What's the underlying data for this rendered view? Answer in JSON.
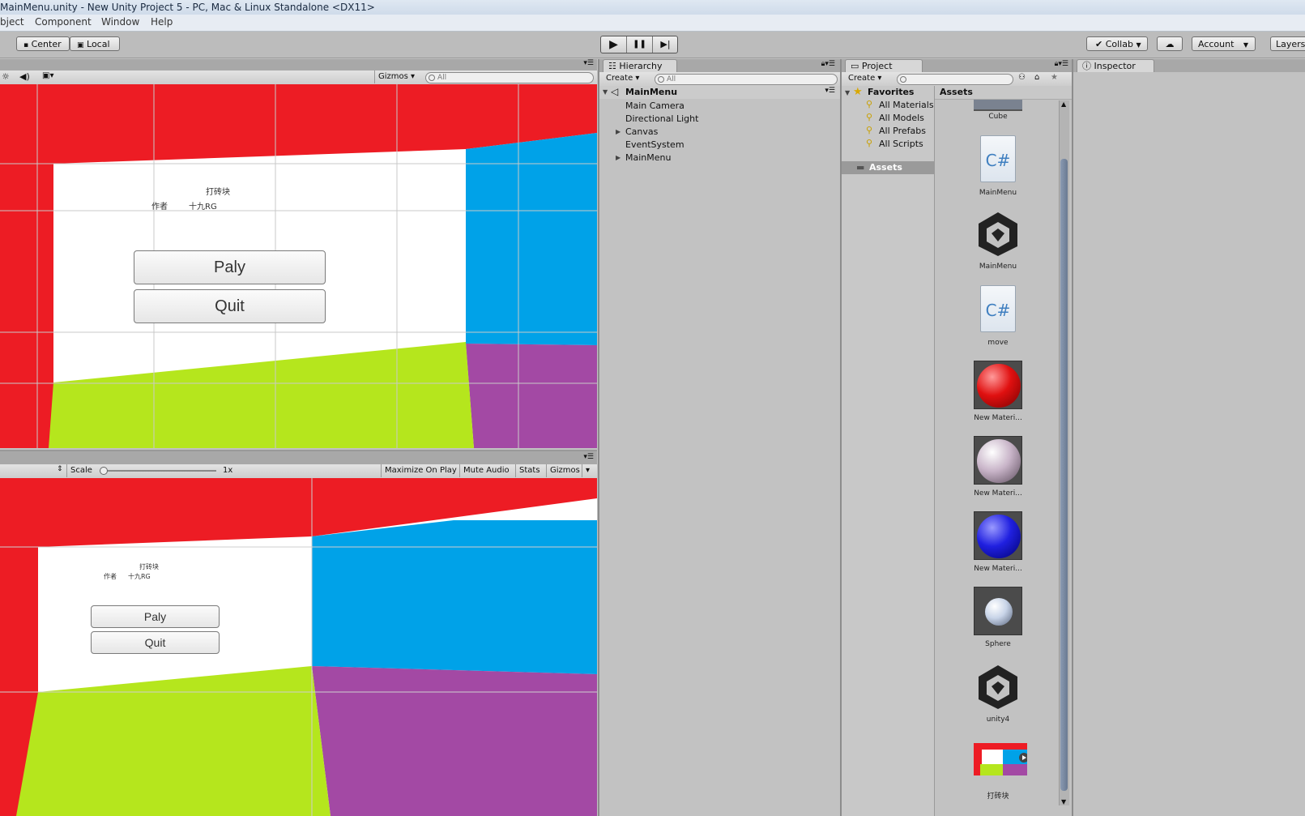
{
  "window": {
    "title": "MainMenu.unity - New Unity Project 5 - PC, Mac & Linux Standalone <DX11>"
  },
  "menu": [
    "bject",
    "Component",
    "Window",
    "Help"
  ],
  "toolbar": {
    "pivot": "Center",
    "space": "Local",
    "play": "▶",
    "pause": "❚❚",
    "step": "▶|",
    "collab": "Collab",
    "account": "Account",
    "layers": "Layers"
  },
  "scene": {
    "gizmos": "Gizmos",
    "search_placeholder": "All",
    "canvas_title": "打砖块",
    "author_label": "作者",
    "author_name": "十九RG",
    "play_button": "Paly",
    "quit_button": "Quit"
  },
  "game": {
    "scale_label": "Scale",
    "scale_value": "1x",
    "scale_fraction": 0.0,
    "maximize": "Maximize On Play",
    "mute": "Mute Audio",
    "stats": "Stats",
    "gizmos": "Gizmos",
    "canvas_title": "打砖块",
    "author_label": "作者",
    "author_name": "十九RG",
    "play_button": "Paly",
    "quit_button": "Quit"
  },
  "hierarchy": {
    "tab": "Hierarchy",
    "create": "Create",
    "search_placeholder": "All",
    "scene_name": "MainMenu",
    "items": [
      "Main Camera",
      "Directional Light",
      "Canvas",
      "EventSystem",
      "MainMenu"
    ]
  },
  "project": {
    "tab": "Project",
    "create": "Create",
    "favorites": "Favorites",
    "favorite_items": [
      "All Materials",
      "All Models",
      "All Prefabs",
      "All Scripts"
    ],
    "assets_folder": "Assets",
    "assets_header": "Assets",
    "assets": [
      "Cube",
      "MainMenu",
      "MainMenu",
      "move",
      "New Materi...",
      "New Materi...",
      "New Materi...",
      "Sphere",
      "unity4",
      "打砖块"
    ]
  },
  "inspector": {
    "tab": "Inspector"
  },
  "colors": {
    "red": "#ed1c24",
    "blue": "#00a2e8",
    "green": "#b5e61d",
    "purple": "#a349a4"
  }
}
